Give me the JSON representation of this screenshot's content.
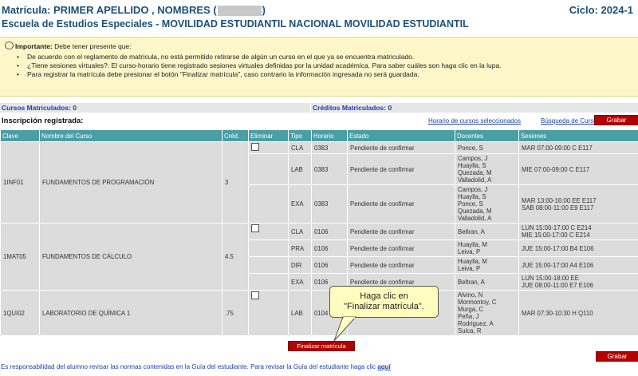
{
  "header": {
    "matricula_prefix": "Matrícula: PRIMER APELLIDO , NOMBRES (",
    "matricula_suffix": ")",
    "school": "Escuela de Estudios Especiales - MOVILIDAD ESTUDIANTIL NACIONAL MOVILIDAD ESTUDIANTIL",
    "ciclo": "Ciclo: 2024-1"
  },
  "notice": {
    "title": "Importante:",
    "title_rest": " Debe tener presente que:",
    "items": [
      "De acuerdo con el reglamento de matrícula, no está permitido retirarse de algún un curso en el que ya se encuentra matriculado.",
      "¿Tiene sesiones virtuales?: El curso-horario tiene registrado sesiones virtuales definidas por la unidad académica. Para saber cuáles son haga clic en la lupa.",
      "Para registrar la matrícula debe presionar el botón \"Finalizar matrícula\", caso contrario la información ingresada no será guardada."
    ]
  },
  "counts": {
    "cursos": "Cursos Matriculados: 0",
    "creditos": "Créditos Matriculados: 0"
  },
  "inscripcion": {
    "title": "Inscripción registrada:",
    "link_horario": "Horario de cursos seleccionados",
    "link_busqueda": "Búsqueda de Cursos",
    "grabar": "Grabar"
  },
  "table": {
    "headers": [
      "Clave",
      "Nombre del Curso",
      "Créd.",
      "Eliminar",
      "Tipo",
      "Horario",
      "Estado",
      "Docentes",
      "Sesiones"
    ],
    "courses": [
      {
        "clave": "1INF01",
        "nombre": "FUNDAMENTOS DE PROGRAMACIÓN",
        "cred": "3",
        "rows": [
          {
            "tipo": "CLA",
            "horario": "0383",
            "estado": "Pendiente de confirmar",
            "docentes": [
              "Ponce, S"
            ],
            "sesiones": [
              "MAR 07:00-09:00 C E117"
            ],
            "checkbox": true
          },
          {
            "tipo": "LAB",
            "horario": "0383",
            "estado": "Pendiente de confirmar",
            "docentes": [
              "Campos, J",
              "Huaylla, S",
              "Quezada, M",
              "Valladolid, A"
            ],
            "sesiones": [
              "MIE 07:00-09:00 C E117"
            ],
            "checkbox": false
          },
          {
            "tipo": "EXA",
            "horario": "0383",
            "estado": "Pendiente de confirmar",
            "docentes": [
              "Campos, J",
              "Huaylla, S",
              "Ponce, S",
              "Quezada, M",
              "Valladolid, A"
            ],
            "sesiones": [
              "MAR 13:00-16:00 EE E117",
              "SAB 08:00-11:00 E9 E117"
            ],
            "checkbox": false
          }
        ]
      },
      {
        "clave": "1MAT05",
        "nombre": "FUNDAMENTOS DE CÁLCULO",
        "cred": "4.5",
        "rows": [
          {
            "tipo": "CLA",
            "horario": "0106",
            "estado": "Pendiente de confirmar",
            "docentes": [
              "Beltran, A"
            ],
            "sesiones": [
              "LUN 15:00-17:00 C E214",
              "MIE 15:00-17:00 C E214"
            ],
            "checkbox": true
          },
          {
            "tipo": "PRA",
            "horario": "0106",
            "estado": "Pendiente de confirmar",
            "docentes": [
              "Huaylla, M",
              "Leiva, P"
            ],
            "sesiones": [
              "JUE 15:00-17:00 B4 E106"
            ],
            "checkbox": false
          },
          {
            "tipo": "DIR",
            "horario": "0106",
            "estado": "Pendiente de confirmar",
            "docentes": [
              "Huaylla, M",
              "Leiva, P"
            ],
            "sesiones": [
              "JUE 15:00-17:00 A4 E106"
            ],
            "checkbox": false
          },
          {
            "tipo": "EXA",
            "horario": "0106",
            "estado": "Pendiente de confirmar",
            "docentes": [
              "Beltran, A"
            ],
            "sesiones": [
              "LUN 15:00-18:00 EE",
              "JUE 08:00-11:00 E7 E106"
            ],
            "checkbox": false
          }
        ]
      },
      {
        "clave": "1QUI02",
        "nombre": "LABORATORIO DE QUÍMICA 1",
        "cred": ".75",
        "rows": [
          {
            "tipo": "LAB",
            "horario": "0104",
            "estado": "",
            "docentes": [
              "Alvino, N",
              "Mormontoy, C",
              "Murga, C",
              "Peña, J",
              "Rodriguez, A",
              "Suica, R"
            ],
            "sesiones": [
              "MAR 07:30-10:30 H Q110"
            ],
            "checkbox": true
          }
        ]
      }
    ]
  },
  "callout": {
    "line1": "Haga clic en",
    "line2": "\"Finalizar matrícula\"."
  },
  "finalizar": "Finalizar matrícula",
  "grabar_bottom": "Grabar",
  "footer": {
    "text": "Es responsabilidad del alumno revisar las normas contenidas en la Guía del estudiante. Para revisar la Guía del estudiante haga clic ",
    "link": "aquí"
  }
}
